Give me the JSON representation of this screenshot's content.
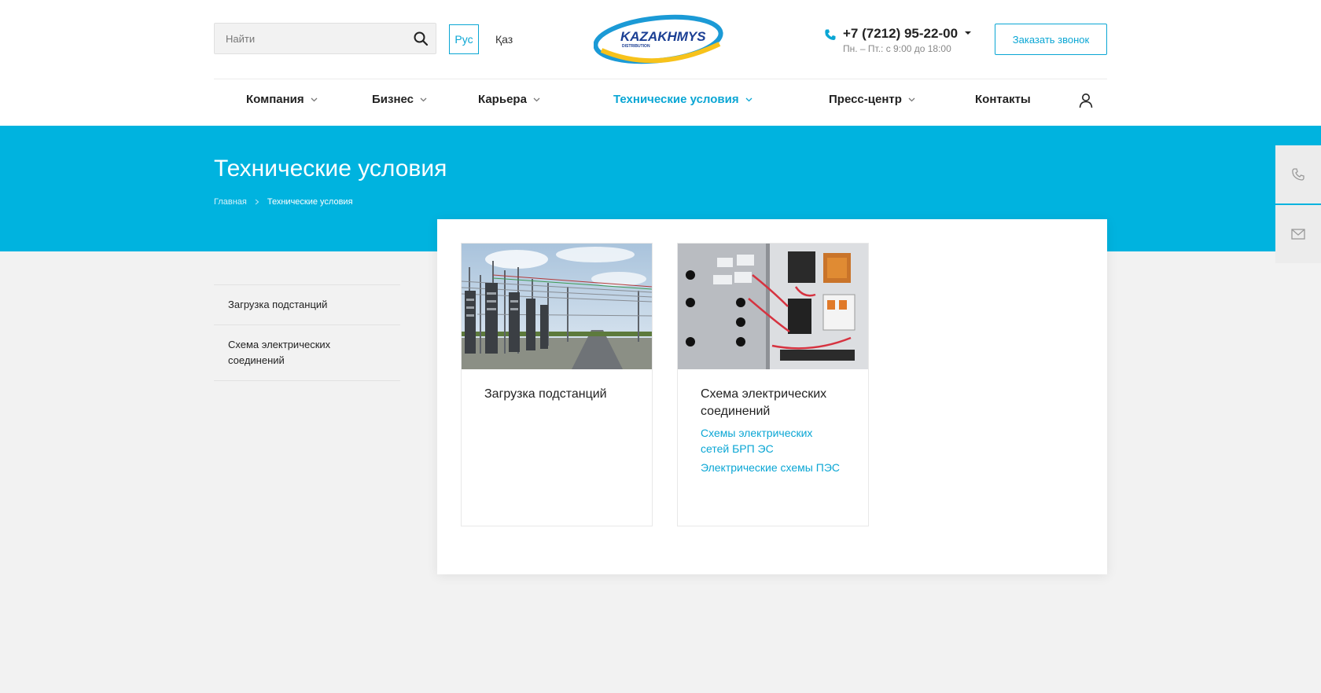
{
  "header": {
    "search_placeholder": "Найти",
    "lang_ru": "Рус",
    "lang_kz": "Қаз",
    "logo_text": "KAZAKHMYS",
    "logo_subtext": "DISTRIBUTION",
    "phone": "+7 (7212) 95-22-00",
    "hours": "Пн. – Пт.: с 9:00 до 18:00",
    "callback_label": "Заказать звонок"
  },
  "nav": {
    "items": [
      {
        "label": "Компания",
        "dropdown": true
      },
      {
        "label": "Бизнес",
        "dropdown": true
      },
      {
        "label": "Карьера",
        "dropdown": true
      },
      {
        "label": "Технические условия",
        "dropdown": true,
        "active": true
      },
      {
        "label": "Пресс-центр",
        "dropdown": true
      },
      {
        "label": "Контакты",
        "dropdown": false
      }
    ]
  },
  "banner": {
    "title": "Технические условия",
    "breadcrumb": [
      "Главная",
      "Технические условия"
    ]
  },
  "sidebar": {
    "items": [
      "Загрузка подстанций",
      "Схема электрических соединений"
    ]
  },
  "cards": [
    {
      "title": "Загрузка подстанций",
      "links": []
    },
    {
      "title": "Схема электрических соединений",
      "links": [
        "Схемы электрических сетей БРП ЭС",
        "Электрические схемы ПЭС"
      ]
    }
  ],
  "colors": {
    "accent": "#0aa6d4",
    "banner": "#00b3df",
    "logo_blue": "#1b3f94",
    "logo_yellow": "#f7c21b"
  }
}
